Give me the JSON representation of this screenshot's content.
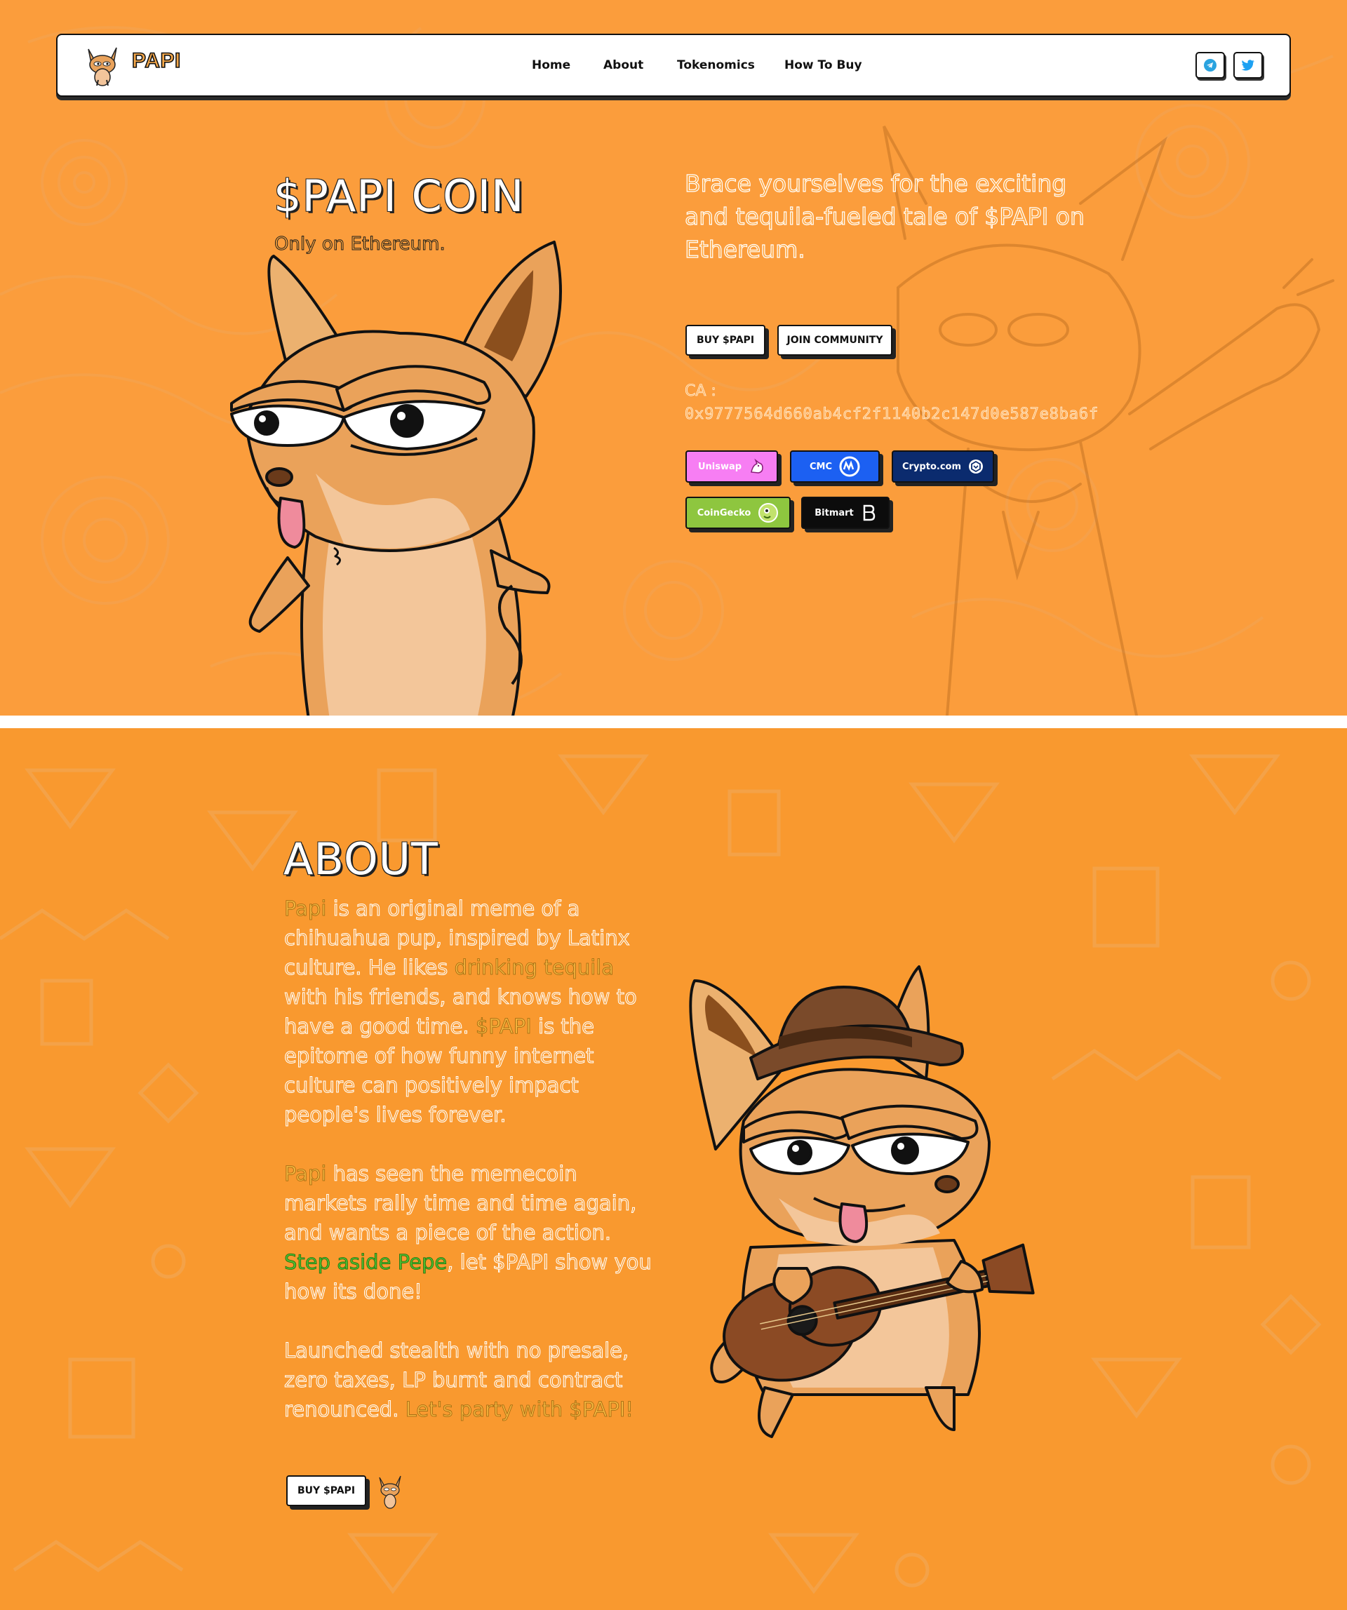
{
  "brand": {
    "name": "PAPI",
    "logo_icon": "chihuahua-logo"
  },
  "nav": {
    "items": [
      "Home",
      "About",
      "Tokenomics",
      "How To Buy"
    ]
  },
  "social": {
    "telegram_icon": "telegram-icon",
    "twitter_icon": "twitter-icon"
  },
  "hero": {
    "title": "$PAPI COIN",
    "subtitle": "Only on Ethereum.",
    "tagline": "Brace yourselves for the exciting and tequila-fueled tale of $PAPI on Ethereum.",
    "buy_label": "BUY $PAPI",
    "join_label": "JOIN COMMUNITY",
    "ca_label": "CA :",
    "ca_address": "0x9777564d660ab4cf2f1140b2c147d0e587e8ba6f",
    "markets": [
      "Uniswap",
      "CMC",
      "Crypto.com",
      "CoinGecko",
      "Bitmart"
    ]
  },
  "about": {
    "title": "ABOUT",
    "p1": {
      "a": "Papi",
      "b": " is an original meme of a chihuahua pup, inspired by Latinx culture. He likes ",
      "c": "drinking tequila",
      "d": " with his friends, and knows how to have a good time. ",
      "e": "$PAPI",
      "f": " is the epitome of how funny internet culture can positively impact people's lives forever."
    },
    "p2": {
      "a": "Papi",
      "b": " has seen the memecoin markets rally time and time again, and wants a piece of the action. ",
      "c": "Step aside Pepe",
      "d": ", let $PAPI show you how its done!"
    },
    "p3": {
      "a": "Launched stealth with no presale, zero taxes, LP burnt and contract renounced. ",
      "b": "Let's party with $PAPI!"
    },
    "buy_label": "BUY $PAPI"
  },
  "colors": {
    "hero_bg": "#fb9d3c",
    "about_bg": "#f9992f",
    "uniswap": "#f77ef3",
    "cmc": "#1c60f2",
    "crypto": "#0b2b6e",
    "coingecko": "#8ec63f",
    "bitmart": "#0c0c0c"
  }
}
